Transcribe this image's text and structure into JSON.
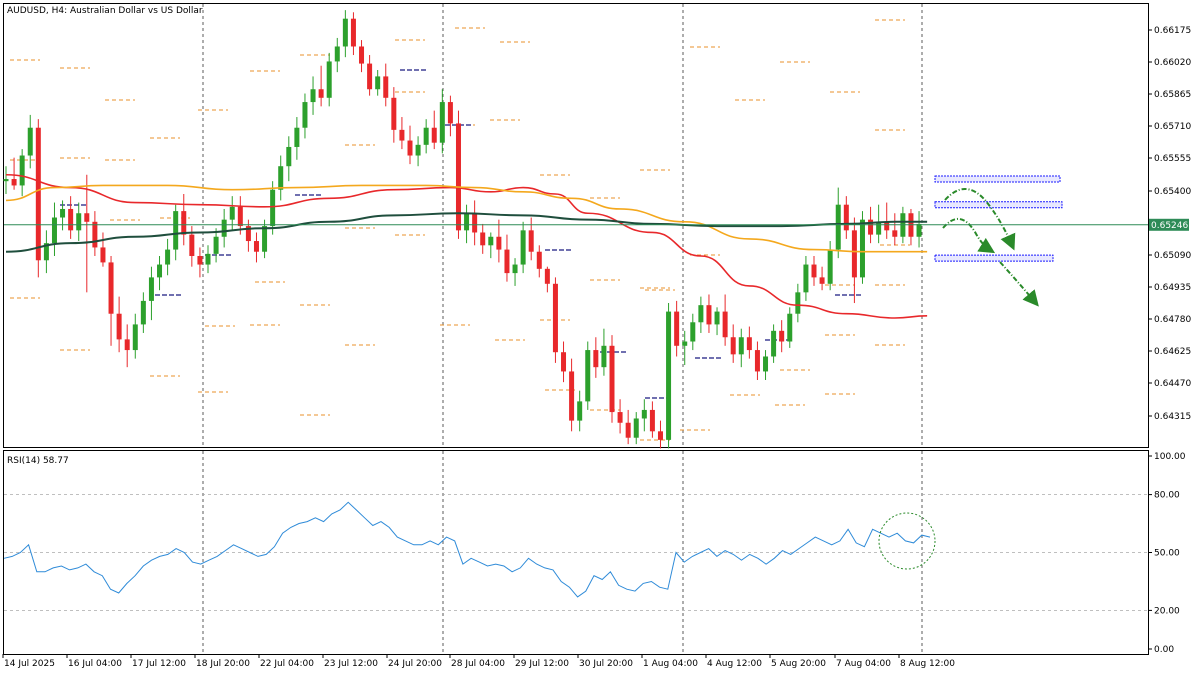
{
  "header": {
    "symbol_title": "AUDUSD, H4:  Australian Dollar vs US Dollar"
  },
  "rsi_panel": {
    "title": "RSI(14) 58.77",
    "levels": [
      "100.00",
      "80.00",
      "50.00",
      "20.00",
      "0.00"
    ]
  },
  "colors": {
    "bull": "#2ca02c",
    "bear": "#e8282b",
    "ma_red": "#e8282b",
    "ma_orange": "#f4a81d",
    "ma_darkgreen": "#1f4e3d",
    "rsi_line": "#2f8bd8",
    "arrow": "#2a8a2a",
    "zone": "#1a1aff",
    "level_orange": "#e8922b",
    "level_navy": "#1a1a80",
    "current_price_line": "#2e8b57"
  },
  "chart_data": {
    "type": "candlestick",
    "price_axis_ticks": [
      "0.66175",
      "0.66020",
      "0.65865",
      "0.65710",
      "0.65555",
      "0.65400",
      "0.65090",
      "0.64935",
      "0.64780",
      "0.64625",
      "0.64470",
      "0.64315"
    ],
    "current_price": "0.65246",
    "time_axis_labels": [
      "14 Jul 2025",
      "16 Jul 04:00",
      "17 Jul 12:00",
      "18 Jul 20:00",
      "22 Jul 04:00",
      "23 Jul 12:00",
      "24 Jul 20:00",
      "28 Jul 04:00",
      "29 Jul 12:00",
      "30 Jul 20:00",
      "1 Aug 04:00",
      "4 Aug 12:00",
      "5 Aug 20:00",
      "7 Aug 04:00",
      "8 Aug 12:00"
    ],
    "ylim": [
      0.6423,
      0.6626
    ],
    "candles": [
      [
        0.6545,
        0.6552,
        0.6539,
        0.6546
      ],
      [
        0.6546,
        0.6556,
        0.6541,
        0.6543
      ],
      [
        0.6543,
        0.656,
        0.6538,
        0.6557
      ],
      [
        0.6557,
        0.6576,
        0.6551,
        0.657
      ],
      [
        0.657,
        0.6574,
        0.65,
        0.6508
      ],
      [
        0.6508,
        0.6522,
        0.6502,
        0.6516
      ],
      [
        0.6516,
        0.6535,
        0.651,
        0.6528
      ],
      [
        0.6528,
        0.6536,
        0.6522,
        0.6532
      ],
      [
        0.6532,
        0.6538,
        0.6518,
        0.6522
      ],
      [
        0.6522,
        0.6535,
        0.6517,
        0.653
      ],
      [
        0.653,
        0.6548,
        0.6493,
        0.6526
      ],
      [
        0.6526,
        0.6531,
        0.651,
        0.6514
      ],
      [
        0.6514,
        0.6521,
        0.6505,
        0.6507
      ],
      [
        0.6507,
        0.651,
        0.6468,
        0.6483
      ],
      [
        0.6483,
        0.6491,
        0.6465,
        0.6471
      ],
      [
        0.6471,
        0.6478,
        0.6458,
        0.6466
      ],
      [
        0.6466,
        0.6483,
        0.6462,
        0.6478
      ],
      [
        0.6478,
        0.6493,
        0.6474,
        0.6489
      ],
      [
        0.6489,
        0.6505,
        0.648,
        0.65
      ],
      [
        0.65,
        0.651,
        0.6494,
        0.6506
      ],
      [
        0.6506,
        0.6518,
        0.6501,
        0.6513
      ],
      [
        0.6513,
        0.6534,
        0.6508,
        0.6531
      ],
      [
        0.6531,
        0.6539,
        0.6515,
        0.652
      ],
      [
        0.652,
        0.6524,
        0.6505,
        0.651
      ],
      [
        0.651,
        0.6514,
        0.65,
        0.6506
      ],
      [
        0.6506,
        0.6515,
        0.6502,
        0.6511
      ],
      [
        0.6511,
        0.6523,
        0.6507,
        0.6519
      ],
      [
        0.6519,
        0.6532,
        0.6514,
        0.6527
      ],
      [
        0.6527,
        0.6538,
        0.6522,
        0.6533
      ],
      [
        0.6533,
        0.6538,
        0.652,
        0.6524
      ],
      [
        0.6524,
        0.6527,
        0.6512,
        0.6517
      ],
      [
        0.6517,
        0.6521,
        0.6507,
        0.6512
      ],
      [
        0.6512,
        0.6527,
        0.6509,
        0.6524
      ],
      [
        0.6524,
        0.6545,
        0.652,
        0.6541
      ],
      [
        0.6541,
        0.6557,
        0.6536,
        0.6552
      ],
      [
        0.6552,
        0.6566,
        0.6545,
        0.6561
      ],
      [
        0.6561,
        0.6575,
        0.6555,
        0.657
      ],
      [
        0.657,
        0.6586,
        0.6565,
        0.6582
      ],
      [
        0.6582,
        0.6594,
        0.6576,
        0.6588
      ],
      [
        0.6588,
        0.6599,
        0.658,
        0.6584
      ],
      [
        0.6584,
        0.6605,
        0.658,
        0.6601
      ],
      [
        0.6601,
        0.6612,
        0.6596,
        0.6608
      ],
      [
        0.6608,
        0.6625,
        0.6603,
        0.6621
      ],
      [
        0.6621,
        0.6624,
        0.6604,
        0.6608
      ],
      [
        0.6608,
        0.6611,
        0.6596,
        0.66
      ],
      [
        0.66,
        0.6604,
        0.6585,
        0.6588
      ],
      [
        0.6588,
        0.6597,
        0.6585,
        0.6594
      ],
      [
        0.6594,
        0.66,
        0.658,
        0.6584
      ],
      [
        0.6584,
        0.6589,
        0.6563,
        0.6569
      ],
      [
        0.6569,
        0.6575,
        0.656,
        0.6564
      ],
      [
        0.6564,
        0.6571,
        0.6553,
        0.6557
      ],
      [
        0.6557,
        0.6566,
        0.6552,
        0.6562
      ],
      [
        0.6562,
        0.6574,
        0.6558,
        0.657
      ],
      [
        0.657,
        0.6578,
        0.656,
        0.6563
      ],
      [
        0.6563,
        0.6588,
        0.6558,
        0.6582
      ],
      [
        0.6582,
        0.6585,
        0.6566,
        0.6572
      ],
      [
        0.6572,
        0.6578,
        0.6518,
        0.6522
      ],
      [
        0.6522,
        0.6534,
        0.6516,
        0.653
      ],
      [
        0.653,
        0.6536,
        0.6515,
        0.6521
      ],
      [
        0.6521,
        0.6525,
        0.6511,
        0.6515
      ],
      [
        0.6515,
        0.6521,
        0.6509,
        0.6519
      ],
      [
        0.6519,
        0.6527,
        0.6507,
        0.6513
      ],
      [
        0.6513,
        0.652,
        0.6498,
        0.6502
      ],
      [
        0.6502,
        0.6509,
        0.6496,
        0.6506
      ],
      [
        0.6506,
        0.6526,
        0.6502,
        0.6522
      ],
      [
        0.6522,
        0.6528,
        0.6508,
        0.6512
      ],
      [
        0.6512,
        0.6515,
        0.65,
        0.6504
      ],
      [
        0.6504,
        0.6505,
        0.6493,
        0.6497
      ],
      [
        0.6497,
        0.65,
        0.646,
        0.6465
      ],
      [
        0.6465,
        0.647,
        0.6451,
        0.6456
      ],
      [
        0.6456,
        0.6462,
        0.6428,
        0.6433
      ],
      [
        0.6433,
        0.6447,
        0.6428,
        0.6442
      ],
      [
        0.6442,
        0.647,
        0.6438,
        0.6466
      ],
      [
        0.6466,
        0.6472,
        0.6453,
        0.6458
      ],
      [
        0.6458,
        0.6476,
        0.6454,
        0.6468
      ],
      [
        0.6468,
        0.6473,
        0.6432,
        0.6437
      ],
      [
        0.6437,
        0.6443,
        0.6427,
        0.6432
      ],
      [
        0.6432,
        0.6438,
        0.6422,
        0.6425
      ],
      [
        0.6425,
        0.6437,
        0.6422,
        0.6434
      ],
      [
        0.6434,
        0.6443,
        0.6428,
        0.6438
      ],
      [
        0.6438,
        0.6442,
        0.6425,
        0.6428
      ],
      [
        0.6428,
        0.6433,
        0.642,
        0.6424
      ],
      [
        0.6424,
        0.6488,
        0.642,
        0.6484
      ],
      [
        0.6484,
        0.6489,
        0.6463,
        0.6468
      ],
      [
        0.6468,
        0.6475,
        0.6459,
        0.647
      ],
      [
        0.647,
        0.6483,
        0.6466,
        0.6479
      ],
      [
        0.6479,
        0.6491,
        0.6474,
        0.6487
      ],
      [
        0.6487,
        0.6492,
        0.6474,
        0.6478
      ],
      [
        0.6478,
        0.6486,
        0.6473,
        0.6484
      ],
      [
        0.6484,
        0.6492,
        0.6468,
        0.6472
      ],
      [
        0.6472,
        0.6478,
        0.646,
        0.6464
      ],
      [
        0.6464,
        0.6476,
        0.6458,
        0.6472
      ],
      [
        0.6472,
        0.6477,
        0.6462,
        0.6466
      ],
      [
        0.6466,
        0.647,
        0.6452,
        0.6456
      ],
      [
        0.6456,
        0.6466,
        0.6452,
        0.6463
      ],
      [
        0.6463,
        0.6478,
        0.646,
        0.6475
      ],
      [
        0.6475,
        0.648,
        0.6465,
        0.647
      ],
      [
        0.647,
        0.6486,
        0.6467,
        0.6483
      ],
      [
        0.6483,
        0.6497,
        0.6479,
        0.6493
      ],
      [
        0.6493,
        0.651,
        0.6489,
        0.6506
      ],
      [
        0.6506,
        0.651,
        0.6496,
        0.65
      ],
      [
        0.65,
        0.6505,
        0.6494,
        0.6497
      ],
      [
        0.6497,
        0.6517,
        0.6494,
        0.6513
      ],
      [
        0.6513,
        0.6542,
        0.6509,
        0.6534
      ],
      [
        0.6534,
        0.6538,
        0.6518,
        0.6522
      ],
      [
        0.6522,
        0.6528,
        0.6488,
        0.65
      ],
      [
        0.65,
        0.6531,
        0.6497,
        0.6527
      ],
      [
        0.6527,
        0.6533,
        0.6516,
        0.652
      ],
      [
        0.652,
        0.6534,
        0.6516,
        0.6526
      ],
      [
        0.6526,
        0.6535,
        0.6518,
        0.6522
      ],
      [
        0.6522,
        0.653,
        0.6515,
        0.6519
      ],
      [
        0.6519,
        0.6533,
        0.6516,
        0.653
      ],
      [
        0.653,
        0.6532,
        0.6515,
        0.6519
      ],
      [
        0.6519,
        0.6531,
        0.6514,
        0.6525
      ]
    ],
    "moving_averages": [
      {
        "color": "red",
        "values": [
          [
            0,
            0.6548
          ],
          [
            8,
            0.6542
          ],
          [
            16,
            0.6535
          ],
          [
            24,
            0.6534
          ],
          [
            32,
            0.6533
          ],
          [
            40,
            0.6537
          ],
          [
            48,
            0.6541
          ],
          [
            55,
            0.6542
          ],
          [
            60,
            0.654
          ],
          [
            64,
            0.6542
          ],
          [
            68,
            0.6539
          ],
          [
            72,
            0.653
          ],
          [
            80,
            0.6521
          ],
          [
            86,
            0.651
          ],
          [
            92,
            0.6496
          ],
          [
            98,
            0.6487
          ],
          [
            104,
            0.6483
          ],
          [
            110,
            0.6481
          ],
          [
            114,
            0.6482
          ]
        ]
      },
      {
        "color": "orange",
        "values": [
          [
            0,
            0.6536
          ],
          [
            6,
            0.6542
          ],
          [
            12,
            0.6543
          ],
          [
            20,
            0.6543
          ],
          [
            28,
            0.6541
          ],
          [
            36,
            0.6542
          ],
          [
            44,
            0.6543
          ],
          [
            52,
            0.6543
          ],
          [
            58,
            0.6542
          ],
          [
            64,
            0.654
          ],
          [
            70,
            0.6537
          ],
          [
            76,
            0.6532
          ],
          [
            84,
            0.6526
          ],
          [
            92,
            0.6518
          ],
          [
            100,
            0.6513
          ],
          [
            106,
            0.6512
          ],
          [
            114,
            0.6512
          ]
        ]
      },
      {
        "color": "darkgreen",
        "values": [
          [
            0,
            0.6512
          ],
          [
            8,
            0.6516
          ],
          [
            16,
            0.6519
          ],
          [
            24,
            0.6521
          ],
          [
            32,
            0.6523
          ],
          [
            40,
            0.6526
          ],
          [
            48,
            0.6529
          ],
          [
            56,
            0.653
          ],
          [
            64,
            0.6529
          ],
          [
            72,
            0.6527
          ],
          [
            80,
            0.6525
          ],
          [
            88,
            0.6524
          ],
          [
            96,
            0.6524
          ],
          [
            104,
            0.6525
          ],
          [
            110,
            0.6526
          ],
          [
            114,
            0.6526
          ]
        ]
      }
    ],
    "rsi": [
      47,
      48,
      50,
      54,
      40,
      40,
      42,
      43,
      41,
      42,
      44,
      40,
      38,
      31,
      29,
      34,
      38,
      43,
      46,
      48,
      49,
      52,
      50,
      45,
      44,
      46,
      48,
      51,
      54,
      52,
      50,
      48,
      49,
      53,
      60,
      63,
      65,
      66,
      68,
      66,
      70,
      72,
      76,
      72,
      68,
      64,
      66,
      63,
      58,
      56,
      54,
      54,
      56,
      54,
      58,
      56,
      44,
      47,
      45,
      43,
      44,
      43,
      40,
      42,
      47,
      44,
      42,
      41,
      35,
      32,
      27,
      30,
      38,
      36,
      40,
      33,
      31,
      30,
      34,
      35,
      32,
      31,
      50,
      45,
      48,
      50,
      52,
      48,
      51,
      49,
      46,
      49,
      47,
      44,
      47,
      51,
      49,
      52,
      55,
      58,
      56,
      54,
      56,
      62,
      55,
      53,
      62,
      60,
      58,
      60,
      56,
      55,
      59,
      58
    ],
    "annotations": {
      "resistance_zones": [
        0.6546,
        0.6534
      ],
      "support_zone": 0.6509,
      "projection": "bearish"
    }
  }
}
